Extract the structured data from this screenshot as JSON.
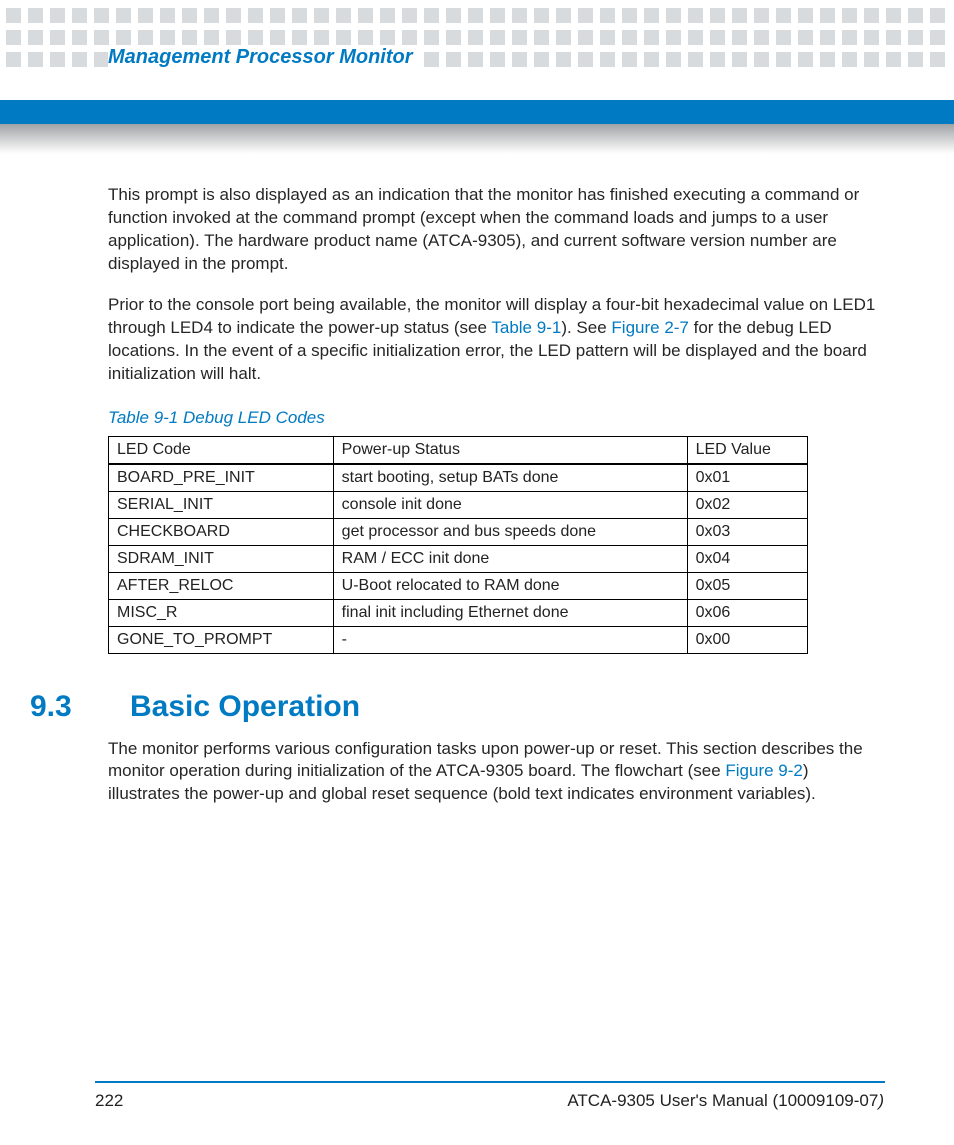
{
  "running_head": "Management Processor Monitor",
  "body": {
    "p1": "This prompt is also displayed as an indication that the monitor has finished executing a command or function invoked at the command prompt (except when the command loads and jumps to a user application). The hardware product name (ATCA-9305), and current software version number are displayed in the prompt.",
    "p2a": "Prior to the console port being available, the monitor will display a four-bit hexadecimal value on LED1 through LED4 to indicate the power-up status (see ",
    "p2_ref1": "Table 9-1",
    "p2b": "). See ",
    "p2_ref2": "Figure 2-7",
    "p2c": " for the debug LED locations. In the event of a specific initialization error, the LED pattern will be displayed and the board initialization will halt."
  },
  "table": {
    "caption": "Table 9-1 Debug LED Codes",
    "headers": [
      "LED Code",
      "Power-up Status",
      "LED Value"
    ],
    "rows": [
      [
        "BOARD_PRE_INIT",
        "start booting, setup BATs done",
        "0x01"
      ],
      [
        "SERIAL_INIT",
        "console init done",
        "0x02"
      ],
      [
        "CHECKBOARD",
        "get processor and bus speeds done",
        "0x03"
      ],
      [
        "SDRAM_INIT",
        "RAM / ECC init done",
        "0x04"
      ],
      [
        "AFTER_RELOC",
        "U-Boot relocated to RAM done",
        "0x05"
      ],
      [
        "MISC_R",
        "final init including Ethernet done",
        "0x06"
      ],
      [
        "GONE_TO_PROMPT",
        "-",
        "0x00"
      ]
    ]
  },
  "section": {
    "number": "9.3",
    "title": "Basic Operation",
    "p1a": "The monitor performs various configuration tasks upon power-up or reset. This section describes the monitor operation during initialization of the ATCA-9305 board. The flowchart (see ",
    "p1_ref": "Figure 9-2",
    "p1b": ") illustrates the power-up and global reset sequence (bold text indicates environment variables)."
  },
  "footer": {
    "page": "222",
    "manual_a": "ATCA-9305 User's Manual (10009109-07",
    "manual_b": ")"
  }
}
